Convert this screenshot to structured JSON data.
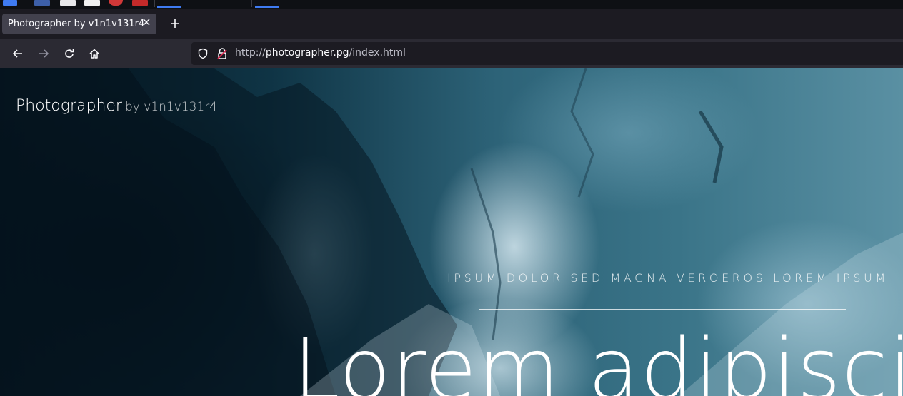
{
  "browser": {
    "tab": {
      "title": "Photographer by v1n1v131r4",
      "close_icon": "close-icon"
    },
    "new_tab_icon": "plus-icon",
    "nav": {
      "back_icon": "arrow-left-icon",
      "forward_icon": "arrow-right-icon",
      "reload_icon": "reload-icon",
      "home_icon": "home-icon"
    },
    "urlbar": {
      "scheme": "http://",
      "host": "photographer.pg",
      "path": "/index.html",
      "shield_icon": "shield-icon",
      "insecure_icon": "insecure-lock-icon"
    }
  },
  "site": {
    "title": "Photographer",
    "byline": "by v1n1v131r4"
  },
  "hero": {
    "subtitle": "IPSUM DOLOR SED MAGNA VEROEROS LOREM IPSUM",
    "title": "Lorem adipisci"
  },
  "colors": {
    "browser_chrome": "#1c1b22",
    "toolbar": "#2b2a33",
    "active_tab": "#42414d",
    "accent": "#3f7bf2",
    "hero_text": "#ffffff"
  }
}
